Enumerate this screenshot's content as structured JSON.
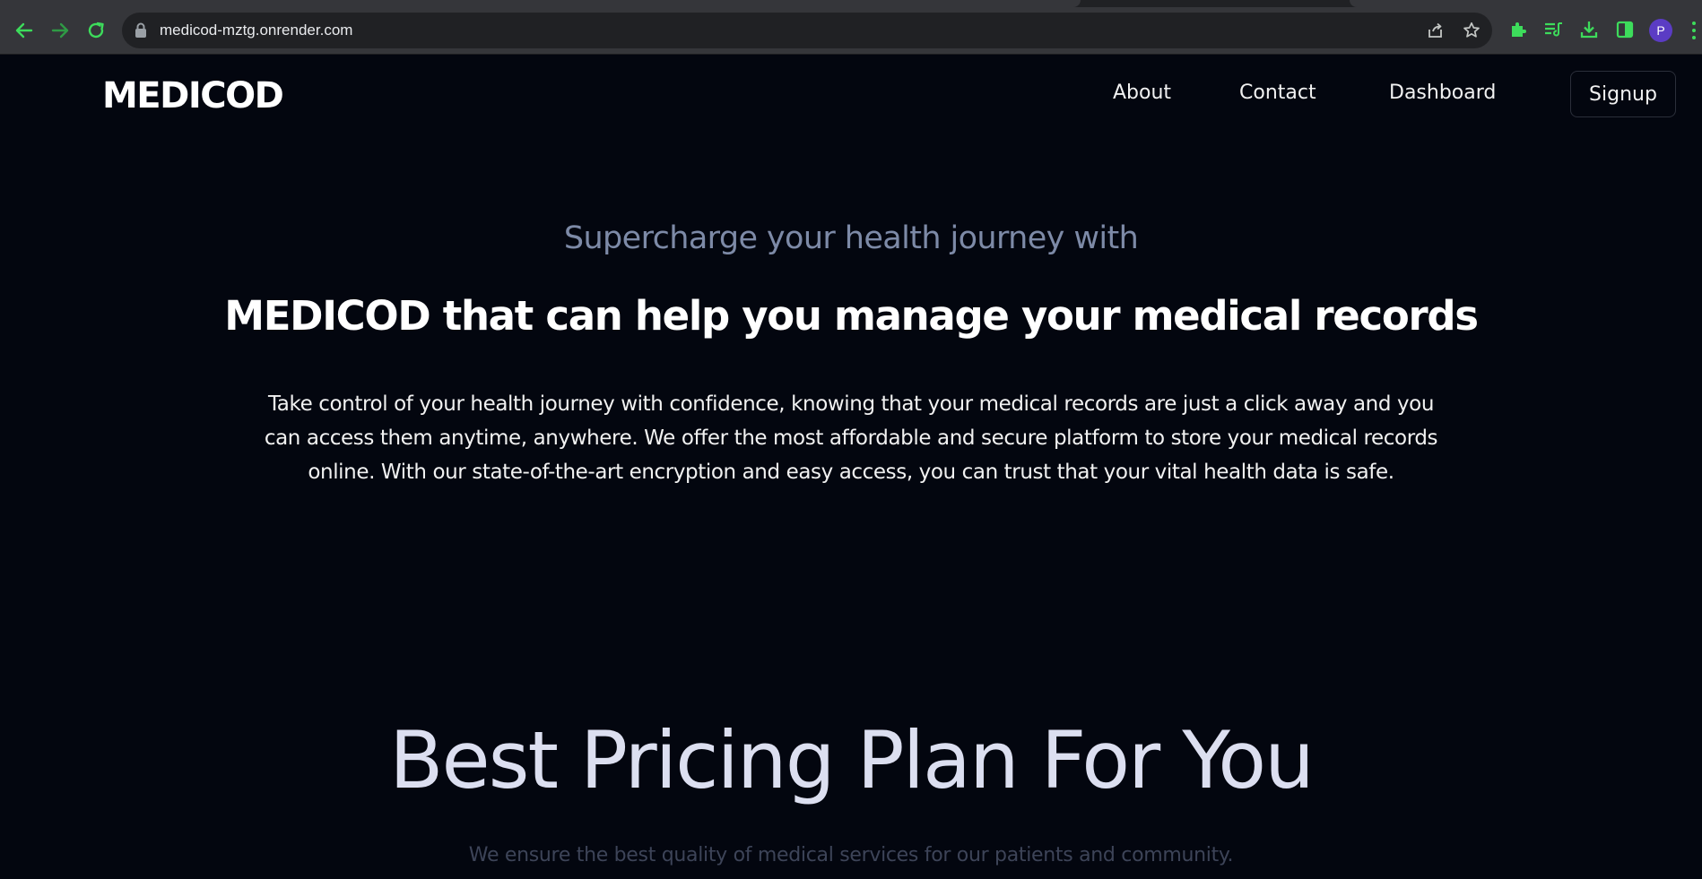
{
  "browser": {
    "url": "medicod-mztg.onrender.com",
    "avatar_initial": "P",
    "accent_color": "#3ddc5b"
  },
  "nav": {
    "logo": "MEDICOD",
    "links": [
      "About",
      "Contact",
      "Dashboard"
    ],
    "signup": "Signup"
  },
  "hero": {
    "subtitle": "Supercharge your health journey with",
    "title": "MEDICOD that can help you manage your medical records",
    "description": "Take control of your health journey with confidence, knowing that your medical records are just a click away and you can access them anytime, anywhere. We offer the most affordable and secure platform to store your medical records online. With our state-of-the-art encryption and easy access, you can trust that your vital health data is safe."
  },
  "pricing": {
    "title": "Best Pricing Plan For You",
    "subtitle": "We ensure the best quality of medical services for our patients and community."
  },
  "colors": {
    "page_background": "#03060f",
    "subtitle": "#7d8aa7",
    "pricing_title": "#dcdff0"
  }
}
